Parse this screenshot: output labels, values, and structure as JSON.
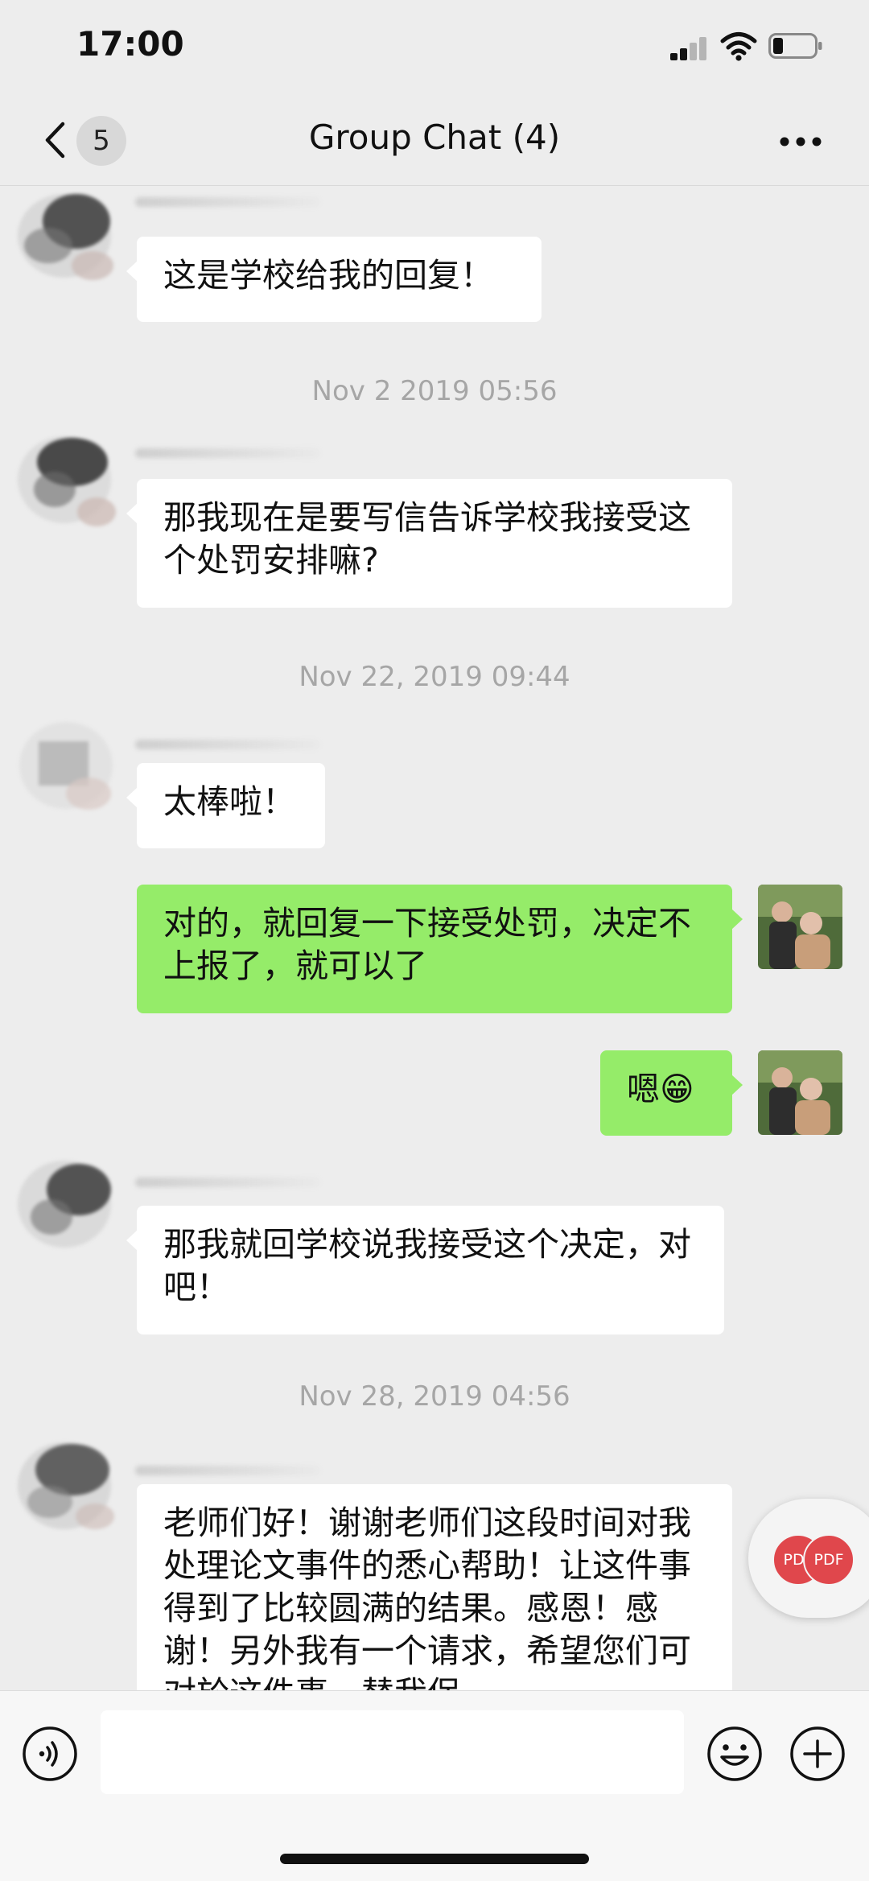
{
  "status_bar": {
    "time": "17:00"
  },
  "nav": {
    "unread_count": "5",
    "title": "Group Chat (4)"
  },
  "messages": {
    "m1": "这是学校给我的回复！",
    "t1": "Nov 2   2019 05:56",
    "m2": "那我现在是要写信告诉学校我接受这个处罚安排嘛?",
    "t2": "Nov 22, 2019 09:44",
    "m3": "太棒啦！",
    "m4": "对的，就回复一下接受处罚，决定不上报了，就可以了",
    "m5": "嗯😁",
    "m6": "那我就回学校说我接受这个决定，对吧！",
    "t3": "Nov 28, 2019 04:56",
    "m7": "老师们好！谢谢老师们这段时间对我处理论文事件的悉心帮助！让这件事得到了比较圆满的结果。感恩！感谢！另外我有一个请求，希望您们可对於这件事，替我保"
  },
  "floating": {
    "pdf_label_1": "PDF",
    "pdf_label_2": "PDF"
  },
  "input": {
    "value": ""
  },
  "colors": {
    "outgoing_bubble": "#95ec69",
    "incoming_bubble": "#ffffff",
    "background": "#ededed",
    "pdf_badge": "#e0474c"
  },
  "icons": {
    "back": "chevron-left-icon",
    "more": "more-dots-icon",
    "voice": "voice-icon",
    "emoji": "emoji-icon",
    "plus": "plus-icon",
    "signal": "signal-icon",
    "wifi": "wifi-icon",
    "battery": "battery-icon"
  }
}
